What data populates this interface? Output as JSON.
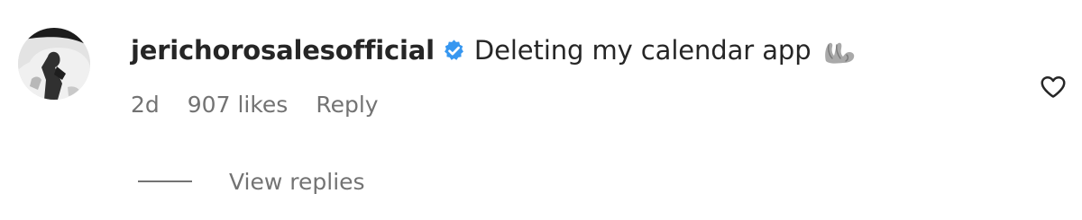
{
  "comment": {
    "username": "jerichorosalesofficial",
    "text": "Deleting my calendar app",
    "avatar": "profile-photo-icon",
    "verified_badge": "verified-icon",
    "emoji": "waving-hand-emoji-icon",
    "like_icon": "heart-outline-icon",
    "meta": {
      "age": "2d",
      "likes": "907 likes",
      "reply": "Reply"
    },
    "view_replies": "View replies"
  },
  "colors": {
    "text_primary": "#262626",
    "text_secondary": "#737373",
    "verified_blue": "#3797f0",
    "background": "#ffffff"
  }
}
